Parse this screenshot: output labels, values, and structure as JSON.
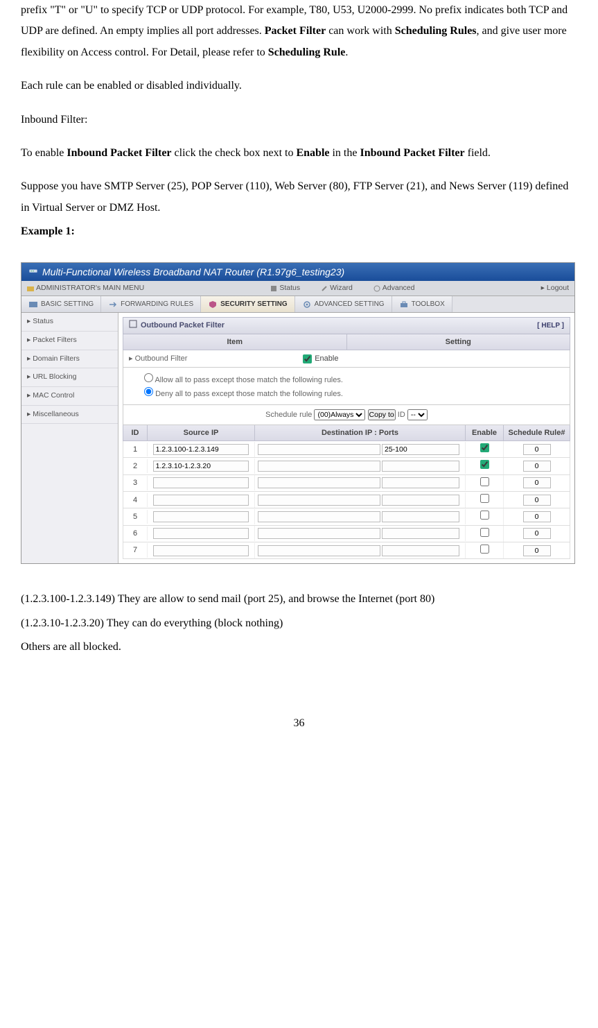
{
  "doc": {
    "p1_a": "prefix \"T\" or \"U\" to specify TCP or UDP protocol. For example, T80, U53, U2000-2999. No prefix indicates both TCP and UDP are defined. An empty implies all port addresses. ",
    "p1_b": "Packet Filter",
    "p1_c": " can work with ",
    "p1_d": "Scheduling Rules",
    "p1_e": ", and give user more flexibility on Access control. For Detail, please refer to ",
    "p1_f": "Scheduling Rule",
    "p1_g": ".",
    "p2": "Each rule can be enabled or disabled individually.",
    "p3": "Inbound Filter:",
    "p4_a": "To enable ",
    "p4_b": "Inbound Packet Filter",
    "p4_c": " click the check box next to ",
    "p4_d": "Enable",
    "p4_e": " in the ",
    "p4_f": "Inbound Packet Filter",
    "p4_g": " field.",
    "p5": "Suppose you have SMTP Server (25), POP Server (110), Web Server (80), FTP Server (21), and News Server (119) defined in Virtual Server or DMZ Host.",
    "p6": "Example 1:",
    "p7": "(1.2.3.100-1.2.3.149) They are allow to send mail (port 25), and browse the Internet (port 80)",
    "p8": "(1.2.3.10-1.2.3.20) They can do everything (block nothing)",
    "p9": "Others are all blocked.",
    "page_number": "36"
  },
  "ui": {
    "title": "Multi-Functional Wireless Broadband NAT Router (R1.97g6_testing23)",
    "menu": {
      "admin": "ADMINISTRATOR's MAIN MENU",
      "status": "Status",
      "wizard": "Wizard",
      "advanced": "Advanced",
      "logout": "Logout"
    },
    "tabs": {
      "basic": "BASIC SETTING",
      "forwarding": "FORWARDING RULES",
      "security": "SECURITY SETTING",
      "advanced": "ADVANCED SETTING",
      "toolbox": "TOOLBOX"
    },
    "sidebar": [
      "Status",
      "Packet Filters",
      "Domain Filters",
      "URL Blocking",
      "MAC Control",
      "Miscellaneous"
    ],
    "panel": {
      "title": "Outbound Packet Filter",
      "help": "[ HELP ]",
      "item_label": "Item",
      "setting_label": "Setting",
      "outbound_label": "Outbound Filter",
      "enable_label": "Enable",
      "radio_allow": "Allow all to pass except those match the following rules.",
      "radio_deny": "Deny all to pass except those match the following rules.",
      "sched_label": "Schedule rule",
      "sched_option": "(00)Always",
      "copy_btn": "Copy to",
      "id_label": "ID",
      "id_option": "--",
      "cols": {
        "id": "ID",
        "src": "Source IP",
        "dst": "Destination IP : Ports",
        "enable": "Enable",
        "sr": "Schedule Rule#"
      },
      "rows": [
        {
          "id": "1",
          "src": "1.2.3.100-1.2.3.149",
          "dst_ip": "",
          "dst_port": "25-100",
          "enable": true,
          "sr": "0"
        },
        {
          "id": "2",
          "src": "1.2.3.10-1.2.3.20",
          "dst_ip": "",
          "dst_port": "",
          "enable": true,
          "sr": "0"
        },
        {
          "id": "3",
          "src": "",
          "dst_ip": "",
          "dst_port": "",
          "enable": false,
          "sr": "0"
        },
        {
          "id": "4",
          "src": "",
          "dst_ip": "",
          "dst_port": "",
          "enable": false,
          "sr": "0"
        },
        {
          "id": "5",
          "src": "",
          "dst_ip": "",
          "dst_port": "",
          "enable": false,
          "sr": "0"
        },
        {
          "id": "6",
          "src": "",
          "dst_ip": "",
          "dst_port": "",
          "enable": false,
          "sr": "0"
        },
        {
          "id": "7",
          "src": "",
          "dst_ip": "",
          "dst_port": "",
          "enable": false,
          "sr": "0"
        }
      ]
    }
  }
}
